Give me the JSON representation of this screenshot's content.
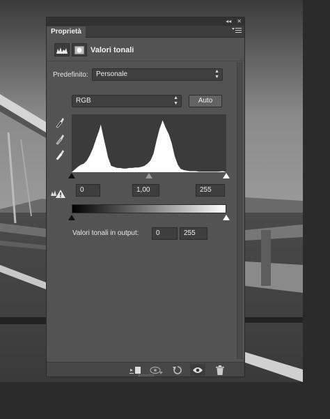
{
  "panel": {
    "tab_title": "Proprietà",
    "window_controls": [
      "◂◂",
      "✕"
    ],
    "menu_icon": "panel-menu-icon",
    "header_title": "Valori tonali",
    "preset_label": "Predefinito:",
    "preset_value": "Personale",
    "channel_value": "RGB",
    "auto_label": "Auto",
    "input_black": "0",
    "input_gamma": "1,00",
    "input_white": "255",
    "output_label": "Valori tonali in output:",
    "output_black": "0",
    "output_white": "255",
    "icons": {
      "levels": "levels-adjustment-icon",
      "mask": "mask-icon",
      "eyedroppers": [
        "black-point-eyedropper-icon",
        "gray-point-eyedropper-icon",
        "white-point-eyedropper-icon"
      ],
      "warning": "histogram-warning-icon",
      "footer": [
        "clip-to-layer-icon",
        "view-previous-state-icon",
        "reset-icon",
        "visibility-eye-icon",
        "trash-icon"
      ]
    }
  },
  "chart_data": {
    "type": "area",
    "title": "",
    "xlabel": "",
    "ylabel": "",
    "xlim": [
      0,
      255
    ],
    "ylim": [
      0,
      100
    ],
    "x": [
      0,
      5,
      10,
      15,
      20,
      25,
      30,
      35,
      40,
      45,
      48,
      52,
      56,
      60,
      65,
      70,
      75,
      80,
      85,
      90,
      95,
      100,
      105,
      110,
      115,
      120,
      125,
      130,
      135,
      140,
      145,
      150,
      155,
      160,
      165,
      170,
      175,
      180,
      185,
      190,
      195,
      200,
      205,
      210,
      215,
      220,
      225,
      230,
      240,
      250,
      255
    ],
    "values": [
      0,
      5,
      10,
      14,
      16,
      22,
      32,
      45,
      62,
      78,
      90,
      68,
      48,
      28,
      12,
      10,
      8,
      8,
      7,
      7,
      8,
      8,
      9,
      9,
      10,
      12,
      16,
      22,
      35,
      60,
      82,
      98,
      84,
      72,
      55,
      30,
      14,
      6,
      4,
      3,
      2,
      2,
      2,
      1,
      1,
      1,
      1,
      1,
      1,
      2,
      0
    ],
    "color": "#ffffff",
    "background": "#3b3b3b"
  }
}
